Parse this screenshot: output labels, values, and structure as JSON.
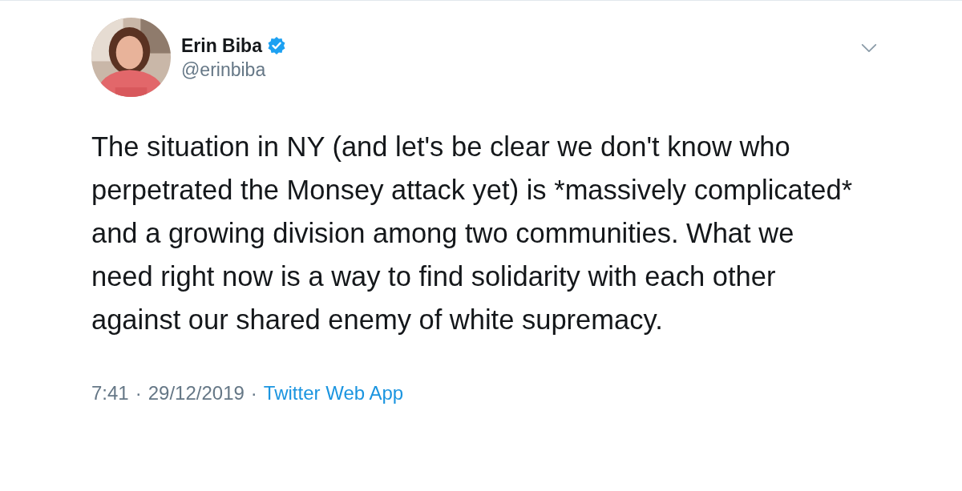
{
  "author": {
    "name": "Erin Biba",
    "handle": "@erinbiba",
    "verified": true
  },
  "tweet": {
    "text": "The situation in NY (and let's be clear we don't know who perpetrated the Monsey attack yet) is *massively complicated* and a growing division among two communities. What we need right now is a way to find solidarity with each other against our shared enemy of white supremacy."
  },
  "meta": [
    {
      "text": "7:41",
      "kind": "plain"
    },
    {
      "text": "·",
      "kind": "plain"
    },
    {
      "text": "29/12/2019",
      "kind": "plain"
    },
    {
      "text": "·",
      "kind": "plain"
    },
    {
      "text": "Twitter Web App",
      "kind": "link"
    }
  ]
}
